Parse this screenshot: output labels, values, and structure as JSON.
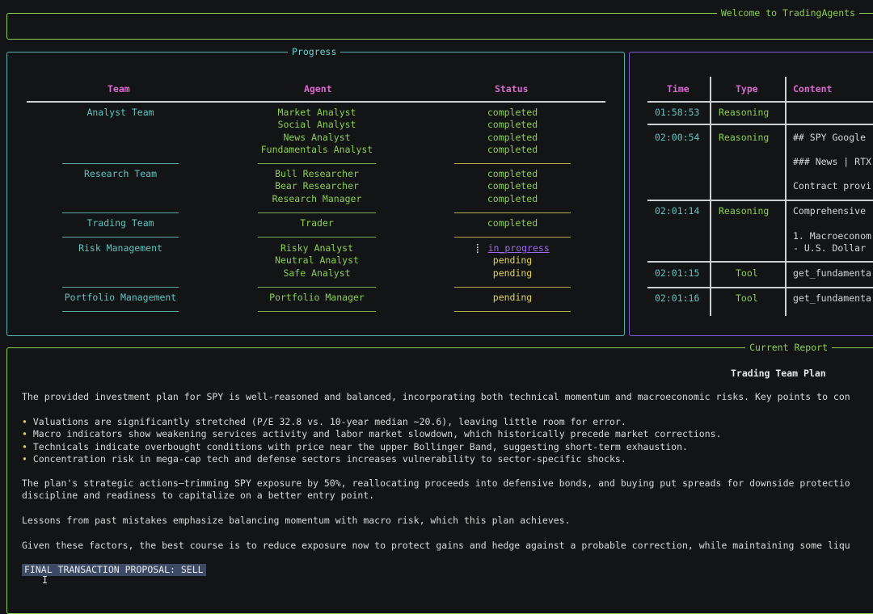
{
  "welcome": {
    "title": "Welcome to TradingAgents"
  },
  "progress": {
    "title": "Progress",
    "headers": {
      "team": "Team",
      "agent": "Agent",
      "status": "Status"
    },
    "rows": [
      {
        "team": "Analyst Team",
        "agent": "Market Analyst",
        "status": "completed"
      },
      {
        "team": "",
        "agent": "Social Analyst",
        "status": "completed"
      },
      {
        "team": "",
        "agent": "News Analyst",
        "status": "completed"
      },
      {
        "team": "",
        "agent": "Fundamentals Analyst",
        "status": "completed"
      },
      {
        "team": "Research Team",
        "agent": "Bull Researcher",
        "status": "completed"
      },
      {
        "team": "",
        "agent": "Bear Researcher",
        "status": "completed"
      },
      {
        "team": "",
        "agent": "Research Manager",
        "status": "completed"
      },
      {
        "team": "Trading Team",
        "agent": "Trader",
        "status": "completed"
      },
      {
        "team": "Risk Management",
        "agent": "Risky Analyst",
        "status": "in_progress",
        "status_prefix": "⡇"
      },
      {
        "team": "",
        "agent": "Neutral Analyst",
        "status": "pending"
      },
      {
        "team": "",
        "agent": "Safe Analyst",
        "status": "pending"
      },
      {
        "team": "Portfolio Management",
        "agent": "Portfolio Manager",
        "status": "pending"
      }
    ]
  },
  "messages": {
    "headers": {
      "time": "Time",
      "type": "Type",
      "content": "Content"
    },
    "rows": [
      {
        "time": "01:58:53",
        "type": "Reasoning",
        "content": [
          ""
        ]
      },
      {
        "time": "02:00:54",
        "type": "Reasoning",
        "content": [
          "## SPY Google",
          "### News | RTX",
          "Contract provi"
        ]
      },
      {
        "time": "02:01:14",
        "type": "Reasoning",
        "content": [
          "Comprehensive",
          "1. Macroeconom",
          "- U.S. Dollar"
        ]
      },
      {
        "time": "02:01:15",
        "type": "Tool",
        "content": [
          "get_fundamenta"
        ]
      },
      {
        "time": "02:01:16",
        "type": "Tool",
        "content": [
          "get_fundamenta"
        ]
      }
    ]
  },
  "report": {
    "title": "Current Report",
    "heading": "Trading Team Plan",
    "intro": "The provided investment plan for SPY is well-reasoned and balanced, incorporating both technical momentum and macroeconomic risks. Key points to con",
    "bullets": [
      "Valuations are significantly stretched (P/E 32.8 vs. 10-year median ~20.6), leaving little room for error.",
      "Macro indicators show weakening services activity and labor market slowdown, which historically precede market corrections.",
      "Technicals indicate overbought conditions with price near the upper Bollinger Band, suggesting short-term exhaustion.",
      "Concentration risk in mega-cap tech and defense sectors increases vulnerability to sector-specific shocks."
    ],
    "strategy_line1": "The plan's strategic actions—trimming SPY exposure by 50%, reallocating proceeds into defensive bonds, and buying put spreads for downside protectio",
    "strategy_line2": "discipline and readiness to capitalize on a better entry point.",
    "lessons": "Lessons from past mistakes emphasize balancing momentum with macro risk, which this plan achieves.",
    "conclusion": "Given these factors, the best course is to reduce exposure now to protect gains and hedge against a probable correction, while maintaining some liqu",
    "final": "FINAL TRANSACTION PROPOSAL: SELL"
  },
  "colors": {
    "background": "#131415",
    "green": "#8ccf52",
    "teal": "#5fc5c1",
    "magenta": "#d86ad0",
    "yellow": "#e3d45a",
    "purple": "#a06bea",
    "selection": "#3c4a66"
  }
}
